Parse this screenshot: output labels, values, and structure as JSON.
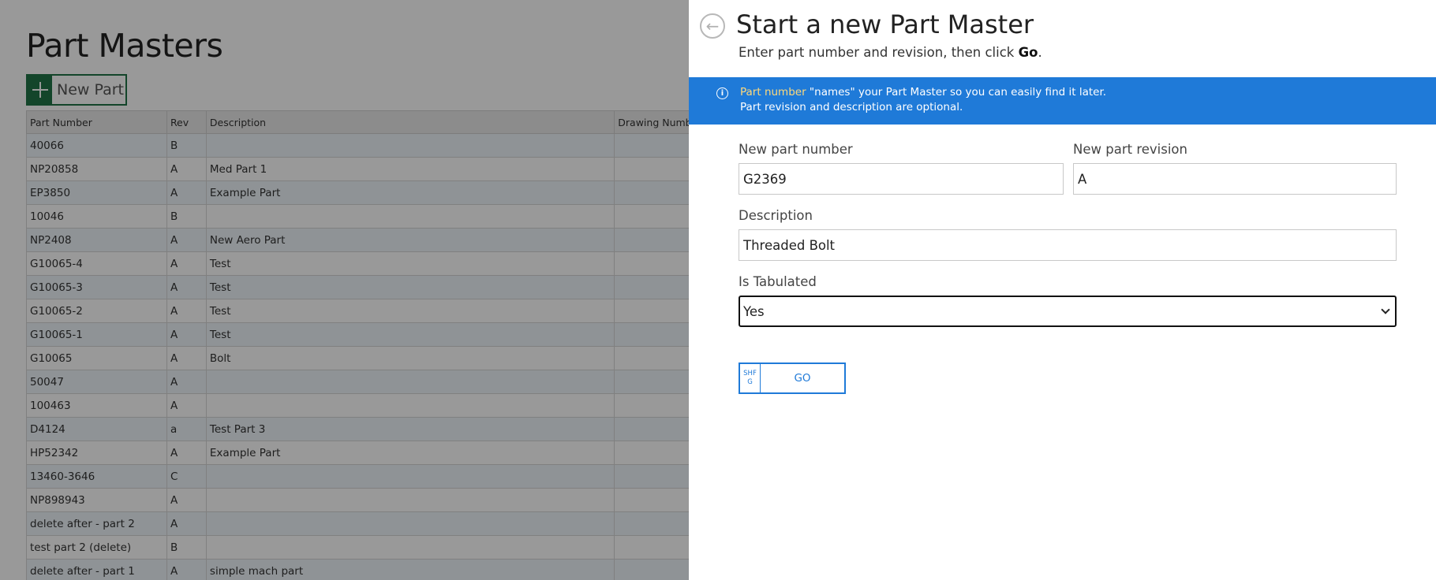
{
  "background": {
    "title": "Part Masters",
    "new_part_label": "New Part",
    "columns": [
      "Part Number",
      "Rev",
      "Description",
      "Drawing Numb"
    ],
    "rows": [
      {
        "part_number": "40066",
        "rev": "B",
        "description": "",
        "drawing": ""
      },
      {
        "part_number": "NP20858",
        "rev": "A",
        "description": "Med Part 1",
        "drawing": ""
      },
      {
        "part_number": "EP3850",
        "rev": "A",
        "description": "Example Part",
        "drawing": ""
      },
      {
        "part_number": "10046",
        "rev": "B",
        "description": "",
        "drawing": ""
      },
      {
        "part_number": "NP2408",
        "rev": "A",
        "description": "New Aero Part",
        "drawing": ""
      },
      {
        "part_number": "G10065-4",
        "rev": "A",
        "description": "Test",
        "drawing": ""
      },
      {
        "part_number": "G10065-3",
        "rev": "A",
        "description": "Test",
        "drawing": ""
      },
      {
        "part_number": "G10065-2",
        "rev": "A",
        "description": "Test",
        "drawing": ""
      },
      {
        "part_number": "G10065-1",
        "rev": "A",
        "description": "Test",
        "drawing": ""
      },
      {
        "part_number": "G10065",
        "rev": "A",
        "description": "Bolt",
        "drawing": ""
      },
      {
        "part_number": "50047",
        "rev": "A",
        "description": "",
        "drawing": ""
      },
      {
        "part_number": "100463",
        "rev": "A",
        "description": "",
        "drawing": ""
      },
      {
        "part_number": "D4124",
        "rev": "a",
        "description": "Test Part 3",
        "drawing": ""
      },
      {
        "part_number": "HP52342",
        "rev": "A",
        "description": "Example Part",
        "drawing": ""
      },
      {
        "part_number": "13460-3646",
        "rev": "C",
        "description": "",
        "drawing": ""
      },
      {
        "part_number": "NP898943",
        "rev": "A",
        "description": "",
        "drawing": ""
      },
      {
        "part_number": "delete after - part 2",
        "rev": "A",
        "description": "",
        "drawing": ""
      },
      {
        "part_number": "test part 2 (delete)",
        "rev": "B",
        "description": "",
        "drawing": ""
      },
      {
        "part_number": "delete after - part 1",
        "rev": "A",
        "description": "simple mach part",
        "drawing": ""
      }
    ]
  },
  "panel": {
    "back_icon": "arrow-left-circle-icon",
    "back_glyph": "←",
    "title": "Start a new Part Master",
    "subtitle_prefix": "Enter part number and revision, then click ",
    "subtitle_bold": "Go",
    "subtitle_suffix": ".",
    "info": {
      "icon": "info-icon",
      "glyph": "i",
      "highlight": "Part number",
      "line1_rest": " \"names\" your Part Master so you can easily find it later.",
      "line2": "Part revision and description are optional."
    },
    "fields": {
      "part_number_label": "New part number",
      "part_number_value": "G2369",
      "revision_label": "New part revision",
      "revision_value": "A",
      "description_label": "Description",
      "description_value": "Threaded Bolt",
      "tabulated_label": "Is Tabulated",
      "tabulated_value": "Yes"
    },
    "go_button": {
      "shortcut": "SHF G",
      "label": "GO"
    }
  },
  "colors": {
    "accent_blue": "#1f7ad8",
    "excel_green": "#217346",
    "info_highlight": "#ffd97a"
  }
}
